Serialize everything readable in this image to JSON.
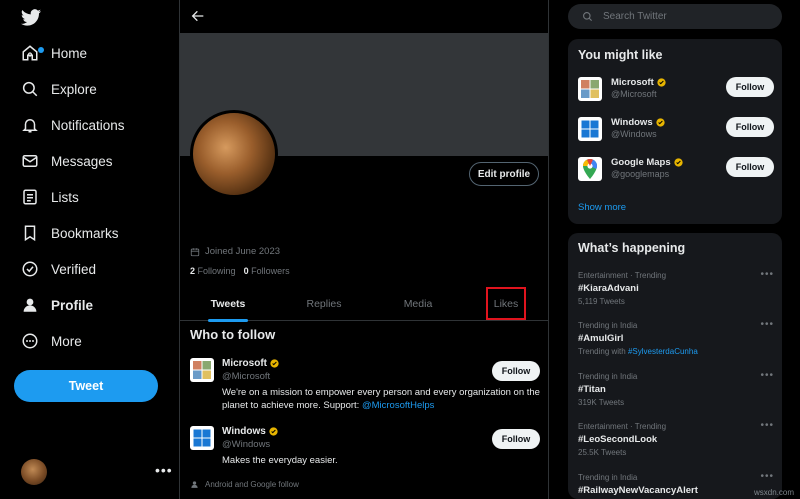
{
  "sidebar": {
    "items": [
      {
        "label": "Home",
        "icon": "home-icon"
      },
      {
        "label": "Explore",
        "icon": "search-icon"
      },
      {
        "label": "Notifications",
        "icon": "bell-icon"
      },
      {
        "label": "Messages",
        "icon": "envelope-icon"
      },
      {
        "label": "Lists",
        "icon": "list-icon"
      },
      {
        "label": "Bookmarks",
        "icon": "bookmark-icon"
      },
      {
        "label": "Verified",
        "icon": "verified-icon"
      },
      {
        "label": "Profile",
        "icon": "person-icon"
      },
      {
        "label": "More",
        "icon": "more-circle-icon"
      }
    ],
    "tweet_label": "Tweet",
    "more_dots": "•••"
  },
  "profile": {
    "edit_label": "Edit profile",
    "joined": "Joined June 2023",
    "following_count": "2",
    "following_label": "Following",
    "followers_count": "0",
    "followers_label": "Followers",
    "tabs": [
      "Tweets",
      "Replies",
      "Media",
      "Likes"
    ]
  },
  "who_to_follow": {
    "title": "Who to follow",
    "items": [
      {
        "name": "Microsoft",
        "handle": "@Microsoft",
        "bio": "We're on a mission to empower every person and every organization on the planet to achieve more. Support: ",
        "bio_link": "@MicrosoftHelps",
        "button": "Follow"
      },
      {
        "name": "Windows",
        "handle": "@Windows",
        "bio": "Makes the everyday easier.",
        "bio_link": "",
        "button": "Follow"
      }
    ],
    "partial_context": "Android and Google follow"
  },
  "search": {
    "placeholder": "Search Twitter"
  },
  "you_might_like": {
    "title": "You might like",
    "items": [
      {
        "name": "Microsoft",
        "handle": "@Microsoft",
        "button": "Follow"
      },
      {
        "name": "Windows",
        "handle": "@Windows",
        "button": "Follow"
      },
      {
        "name": "Google Maps",
        "handle": "@googlemaps",
        "button": "Follow"
      }
    ],
    "show_more": "Show more"
  },
  "whats_happening": {
    "title": "What’s happening",
    "items": [
      {
        "context": "Entertainment · Trending",
        "topic": "#KiaraAdvani",
        "count": "5,119 Tweets",
        "link": ""
      },
      {
        "context": "Trending in India",
        "topic": "#AmulGirl",
        "count": "Trending with ",
        "link": "#SylvesterdaCunha"
      },
      {
        "context": "Trending in India",
        "topic": "#Titan",
        "count": "319K Tweets",
        "link": ""
      },
      {
        "context": "Entertainment · Trending",
        "topic": "#LeoSecondLook",
        "count": "25.5K Tweets",
        "link": ""
      },
      {
        "context": "Trending in India",
        "topic": "#RailwayNewVacancyAlert",
        "count": "",
        "link": ""
      }
    ]
  },
  "colors": {
    "accent": "#1d9bf0",
    "highlight_box": "#e0141e",
    "verified": "#e8b500"
  },
  "watermark": "wsxdn.com"
}
